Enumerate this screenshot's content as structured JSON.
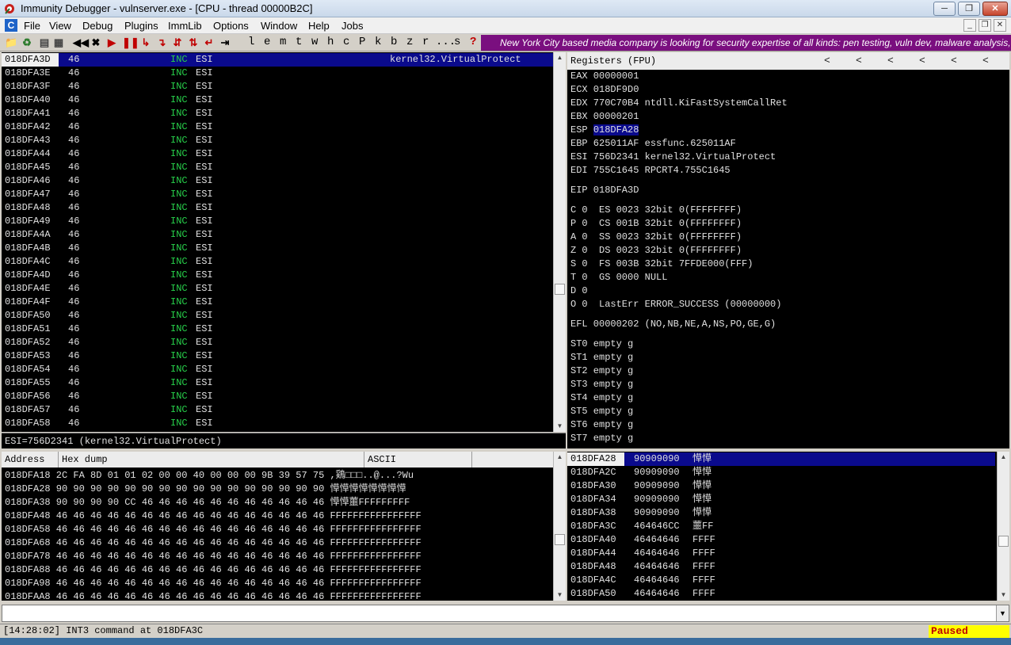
{
  "window": {
    "title": "Immunity Debugger - vulnserver.exe - [CPU - thread 00000B2C]",
    "min_icon": "minimize-icon",
    "max_icon": "maximize-icon",
    "close_icon": "close-icon"
  },
  "menu": {
    "items": [
      "File",
      "View",
      "Debug",
      "Plugins",
      "ImmLib",
      "Options",
      "Window",
      "Help",
      "Jobs"
    ],
    "app_badge": "C"
  },
  "toolbar": {
    "letters": [
      "l",
      "e",
      "m",
      "t",
      "w",
      "h",
      "c",
      "P",
      "k",
      "b",
      "z",
      "r",
      "...",
      "s",
      "?"
    ],
    "banner": "New York City based media company is looking for security expertise of all kinds: pen testing, vuln dev, malware analysis, cloud an"
  },
  "disasm": {
    "rows": [
      {
        "addr": "018DFA3D",
        "hex": "46",
        "mn": "INC",
        "op": "ESI",
        "comment": "kernel32.VirtualProtect"
      },
      {
        "addr": "018DFA3E",
        "hex": "46",
        "mn": "INC",
        "op": "ESI",
        "comment": ""
      },
      {
        "addr": "018DFA3F",
        "hex": "46",
        "mn": "INC",
        "op": "ESI",
        "comment": ""
      },
      {
        "addr": "018DFA40",
        "hex": "46",
        "mn": "INC",
        "op": "ESI",
        "comment": ""
      },
      {
        "addr": "018DFA41",
        "hex": "46",
        "mn": "INC",
        "op": "ESI",
        "comment": ""
      },
      {
        "addr": "018DFA42",
        "hex": "46",
        "mn": "INC",
        "op": "ESI",
        "comment": ""
      },
      {
        "addr": "018DFA43",
        "hex": "46",
        "mn": "INC",
        "op": "ESI",
        "comment": ""
      },
      {
        "addr": "018DFA44",
        "hex": "46",
        "mn": "INC",
        "op": "ESI",
        "comment": ""
      },
      {
        "addr": "018DFA45",
        "hex": "46",
        "mn": "INC",
        "op": "ESI",
        "comment": ""
      },
      {
        "addr": "018DFA46",
        "hex": "46",
        "mn": "INC",
        "op": "ESI",
        "comment": ""
      },
      {
        "addr": "018DFA47",
        "hex": "46",
        "mn": "INC",
        "op": "ESI",
        "comment": ""
      },
      {
        "addr": "018DFA48",
        "hex": "46",
        "mn": "INC",
        "op": "ESI",
        "comment": ""
      },
      {
        "addr": "018DFA49",
        "hex": "46",
        "mn": "INC",
        "op": "ESI",
        "comment": ""
      },
      {
        "addr": "018DFA4A",
        "hex": "46",
        "mn": "INC",
        "op": "ESI",
        "comment": ""
      },
      {
        "addr": "018DFA4B",
        "hex": "46",
        "mn": "INC",
        "op": "ESI",
        "comment": ""
      },
      {
        "addr": "018DFA4C",
        "hex": "46",
        "mn": "INC",
        "op": "ESI",
        "comment": ""
      },
      {
        "addr": "018DFA4D",
        "hex": "46",
        "mn": "INC",
        "op": "ESI",
        "comment": ""
      },
      {
        "addr": "018DFA4E",
        "hex": "46",
        "mn": "INC",
        "op": "ESI",
        "comment": ""
      },
      {
        "addr": "018DFA4F",
        "hex": "46",
        "mn": "INC",
        "op": "ESI",
        "comment": ""
      },
      {
        "addr": "018DFA50",
        "hex": "46",
        "mn": "INC",
        "op": "ESI",
        "comment": ""
      },
      {
        "addr": "018DFA51",
        "hex": "46",
        "mn": "INC",
        "op": "ESI",
        "comment": ""
      },
      {
        "addr": "018DFA52",
        "hex": "46",
        "mn": "INC",
        "op": "ESI",
        "comment": ""
      },
      {
        "addr": "018DFA53",
        "hex": "46",
        "mn": "INC",
        "op": "ESI",
        "comment": ""
      },
      {
        "addr": "018DFA54",
        "hex": "46",
        "mn": "INC",
        "op": "ESI",
        "comment": ""
      },
      {
        "addr": "018DFA55",
        "hex": "46",
        "mn": "INC",
        "op": "ESI",
        "comment": ""
      },
      {
        "addr": "018DFA56",
        "hex": "46",
        "mn": "INC",
        "op": "ESI",
        "comment": ""
      },
      {
        "addr": "018DFA57",
        "hex": "46",
        "mn": "INC",
        "op": "ESI",
        "comment": ""
      },
      {
        "addr": "018DFA58",
        "hex": "46",
        "mn": "INC",
        "op": "ESI",
        "comment": ""
      }
    ],
    "info_line": "ESI=756D2341 (kernel32.VirtualProtect)"
  },
  "registers": {
    "header": "Registers (FPU)",
    "lines": [
      "EAX 00000001",
      "ECX 018DF9D0",
      "EDX 770C70B4 ntdll.KiFastSystemCallRet",
      "EBX 00000201",
      "ESP 018DFA28",
      "EBP 625011AF essfunc.625011AF",
      "ESI 756D2341 kernel32.VirtualProtect",
      "EDI 755C1645 RPCRT4.755C1645",
      "",
      "EIP 018DFA3D",
      "",
      "C 0  ES 0023 32bit 0(FFFFFFFF)",
      "P 0  CS 001B 32bit 0(FFFFFFFF)",
      "A 0  SS 0023 32bit 0(FFFFFFFF)",
      "Z 0  DS 0023 32bit 0(FFFFFFFF)",
      "S 0  FS 003B 32bit 7FFDE000(FFF)",
      "T 0  GS 0000 NULL",
      "D 0",
      "O 0  LastErr ERROR_SUCCESS (00000000)",
      "",
      "EFL 00000202 (NO,NB,NE,A,NS,PO,GE,G)",
      "",
      "ST0 empty g",
      "ST1 empty g",
      "ST2 empty g",
      "ST3 empty g",
      "ST4 empty g",
      "ST5 empty g",
      "ST6 empty g",
      "ST7 empty g"
    ],
    "esp_label": "ESP",
    "esp_value": "018DFA28"
  },
  "dump": {
    "col_address": "Address",
    "col_hex": "Hex dump",
    "col_ascii": "ASCII",
    "rows": [
      "018DFA18 2C FA 8D 01 01 02 00 00 40 00 00 00 9B 39 57 75 ,鶏□□□..@...?Wu",
      "018DFA28 90 90 90 90 90 90 90 90 90 90 90 90 90 90 90 90 愺愺愺愺愺愺愺愺",
      "018DFA38 90 90 90 90 CC 46 46 46 46 46 46 46 46 46 46 46 愺愺蘁FFFFFFFFF",
      "018DFA48 46 46 46 46 46 46 46 46 46 46 46 46 46 46 46 46 FFFFFFFFFFFFFFFF",
      "018DFA58 46 46 46 46 46 46 46 46 46 46 46 46 46 46 46 46 FFFFFFFFFFFFFFFF",
      "018DFA68 46 46 46 46 46 46 46 46 46 46 46 46 46 46 46 46 FFFFFFFFFFFFFFFF",
      "018DFA78 46 46 46 46 46 46 46 46 46 46 46 46 46 46 46 46 FFFFFFFFFFFFFFFF",
      "018DFA88 46 46 46 46 46 46 46 46 46 46 46 46 46 46 46 46 FFFFFFFFFFFFFFFF",
      "018DFA98 46 46 46 46 46 46 46 46 46 46 46 46 46 46 46 46 FFFFFFFFFFFFFFFF",
      "018DFAA8 46 46 46 46 46 46 46 46 46 46 46 46 46 46 46 46 FFFFFFFFFFFFFFFF"
    ]
  },
  "stack": {
    "rows": [
      {
        "addr": "018DFA28",
        "val": "90909090",
        "com": "愺愺"
      },
      {
        "addr": "018DFA2C",
        "val": "90909090",
        "com": "愺愺"
      },
      {
        "addr": "018DFA30",
        "val": "90909090",
        "com": "愺愺"
      },
      {
        "addr": "018DFA34",
        "val": "90909090",
        "com": "愺愺"
      },
      {
        "addr": "018DFA38",
        "val": "90909090",
        "com": "愺愺"
      },
      {
        "addr": "018DFA3C",
        "val": "464646CC",
        "com": "蘁FF"
      },
      {
        "addr": "018DFA40",
        "val": "46464646",
        "com": "FFFF"
      },
      {
        "addr": "018DFA44",
        "val": "46464646",
        "com": "FFFF"
      },
      {
        "addr": "018DFA48",
        "val": "46464646",
        "com": "FFFF"
      },
      {
        "addr": "018DFA4C",
        "val": "46464646",
        "com": "FFFF"
      },
      {
        "addr": "018DFA50",
        "val": "46464646",
        "com": "FFFF"
      }
    ]
  },
  "command": {
    "value": ""
  },
  "status": {
    "message": "[14:28:02] INT3 command at 018DFA3C",
    "state": "Paused"
  },
  "colors": {
    "selection": "#0a0a8c",
    "mnemonic": "#27d04a",
    "banner": "#7a0f7f",
    "paused_bg": "#ffff00",
    "paused_fg": "#c00000"
  }
}
